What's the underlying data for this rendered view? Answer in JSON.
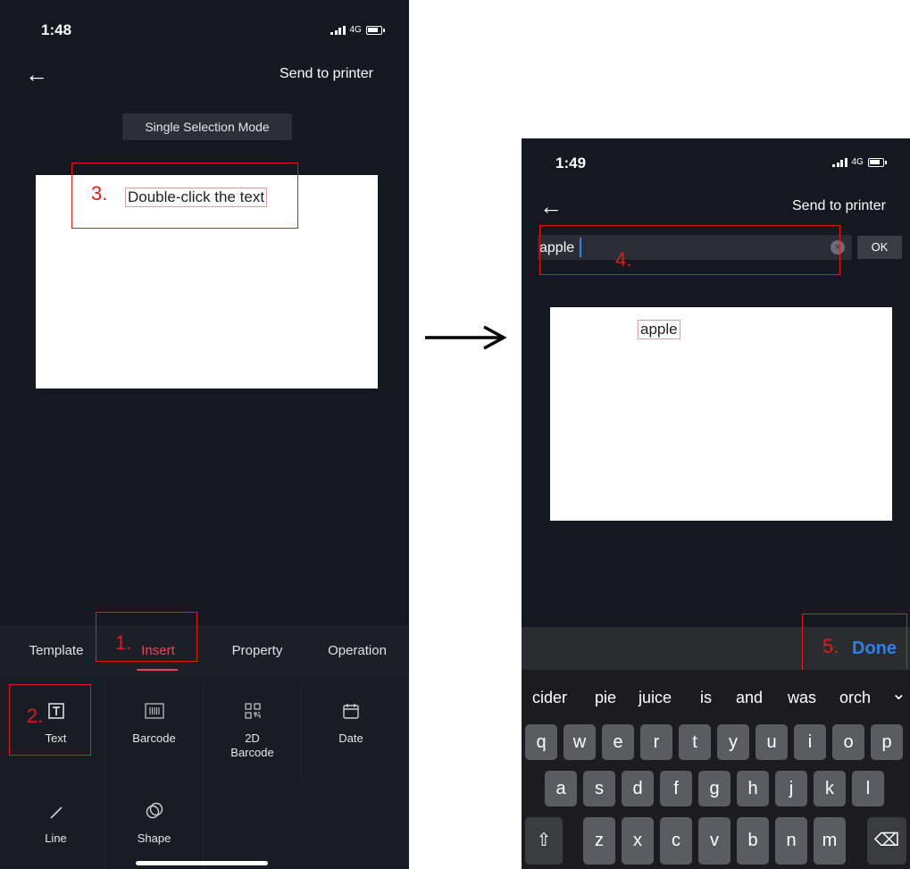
{
  "left": {
    "status": {
      "time": "1:48",
      "network": "4G"
    },
    "nav": {
      "back_icon": "←",
      "send_label": "Send to printer"
    },
    "mode_label": "Single Selection Mode",
    "canvas_text": "Double-click the text",
    "tabs": [
      {
        "label": "Template",
        "active": false
      },
      {
        "label": "Insert",
        "active": true
      },
      {
        "label": "Property",
        "active": false
      },
      {
        "label": "Operation",
        "active": false
      }
    ],
    "tools": {
      "text": "Text",
      "barcode": "Barcode",
      "barcode2d_line1": "2D",
      "barcode2d_line2": "Barcode",
      "date": "Date",
      "line": "Line",
      "shape": "Shape"
    },
    "annotations": {
      "n1": "1.",
      "n2": "2.",
      "n3": "3."
    }
  },
  "arrow_icon": "right-arrow-icon",
  "right": {
    "status": {
      "time": "1:49",
      "network": "4G"
    },
    "nav": {
      "back_icon": "←",
      "send_label": "Send to printer"
    },
    "input_value": "apple",
    "clear_icon": "×",
    "ok_label": "OK",
    "canvas_text": "apple",
    "done_label": "Done",
    "suggestions": [
      "cider",
      "pie",
      "juice",
      "is",
      "and",
      "was",
      "orch"
    ],
    "suggest_chevron": "⌄",
    "keys_row1": [
      "q",
      "w",
      "e",
      "r",
      "t",
      "y",
      "u",
      "i",
      "o",
      "p"
    ],
    "keys_row2": [
      "a",
      "s",
      "d",
      "f",
      "g",
      "h",
      "j",
      "k",
      "l"
    ],
    "keys_row3": [
      "z",
      "x",
      "c",
      "v",
      "b",
      "n",
      "m"
    ],
    "shift_icon": "⇧",
    "backspace_icon": "⌫",
    "annotations": {
      "n4": "4.",
      "n5": "5."
    }
  },
  "colors": {
    "accent": "#e4485d",
    "annotation": "#e21a1a",
    "done": "#2f80ed",
    "background": "#161821"
  }
}
